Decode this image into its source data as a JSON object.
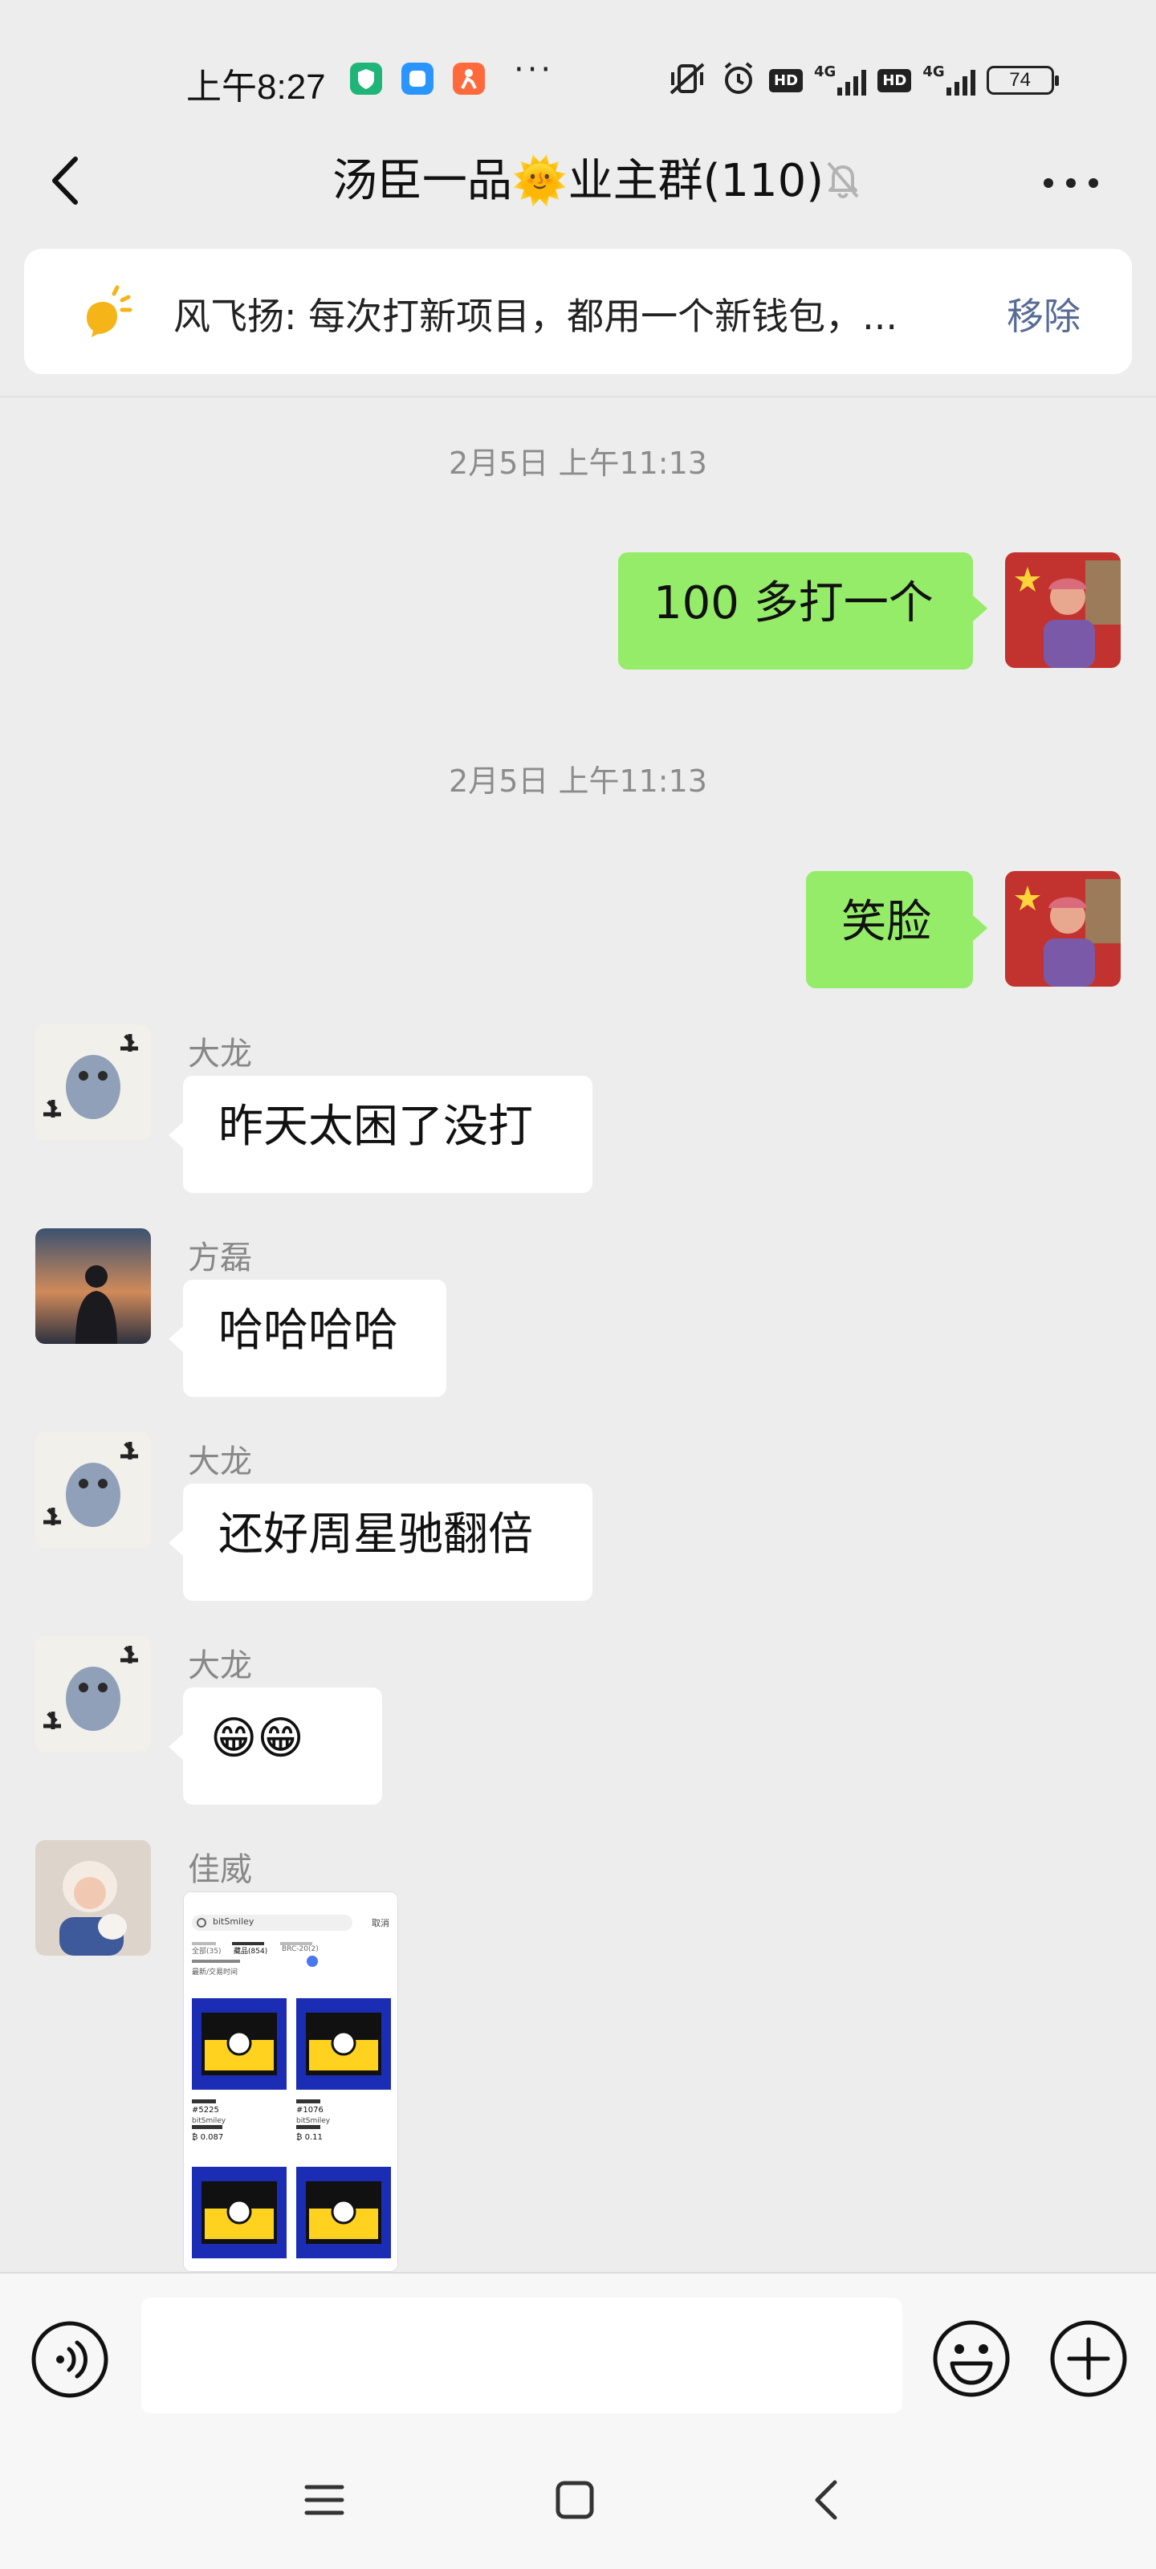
{
  "status_bar": {
    "time": "上午8:27",
    "dots": "···",
    "hd_label": "HD",
    "net_label": "4G",
    "battery": "74",
    "app_icons": [
      "green-shield-app-icon",
      "blue-app-icon",
      "orange-person-app-icon"
    ],
    "colors": {
      "app1": "#1fb478",
      "app2": "#2a95ff",
      "app3": "#ff6a3d"
    }
  },
  "header": {
    "title_part1": "汤臣一品",
    "title_emoji": "🌞",
    "title_part2": "业主群(110)",
    "muted": true
  },
  "pinned": {
    "text": "风飞扬: 每次打新项目，都用一个新钱包，...",
    "remove_label": "移除",
    "colors": {
      "icon": "#f5b417",
      "link": "#576b95"
    }
  },
  "messages": [
    {
      "type": "timestamp",
      "text": "2月5日 上午11:13"
    },
    {
      "type": "outgoing",
      "text": "100 多打一个"
    },
    {
      "type": "timestamp",
      "text": "2月5日 上午11:13"
    },
    {
      "type": "outgoing",
      "text": "笑脸"
    },
    {
      "type": "incoming",
      "sender": "大龙",
      "text": "昨天太困了没打"
    },
    {
      "type": "incoming",
      "sender": "方磊",
      "text": "哈哈哈哈"
    },
    {
      "type": "incoming",
      "sender": "大龙",
      "text": "还好周星驰翻倍"
    },
    {
      "type": "incoming",
      "sender": "大龙",
      "text": "😁😁"
    },
    {
      "type": "incoming-image",
      "sender": "佳威"
    }
  ],
  "image_preview": {
    "search_text": "bitSmiley",
    "tabs": [
      "全部(35)",
      "藏品(854)",
      "BRC-20(2)"
    ],
    "filter": "最新/交易时间",
    "items": [
      {
        "id": "#5225",
        "name": "bitSmiley",
        "price": "₿ 0.087"
      },
      {
        "id": "#1076",
        "name": "bitSmiley",
        "price": "₿ 0.11"
      }
    ],
    "cancel": "取消"
  },
  "colors": {
    "outgoing_bubble": "#95ec69",
    "incoming_bubble": "#ffffff",
    "background": "#ededed"
  }
}
